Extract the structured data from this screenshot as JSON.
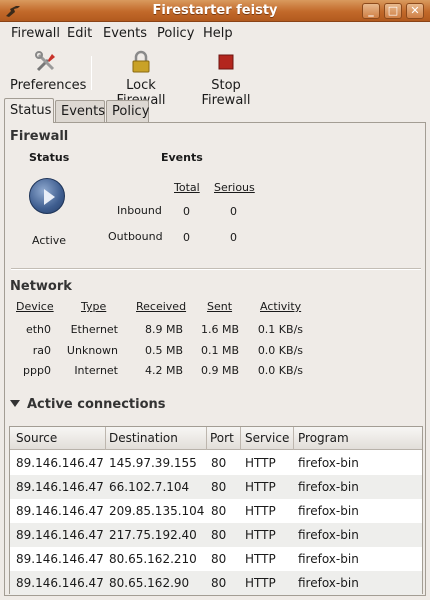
{
  "window": {
    "title": "Firestarter feisty",
    "controls": {
      "minimize": "_",
      "maximize": "□",
      "close": "✕"
    }
  },
  "menu": {
    "items": [
      "Firewall",
      "Edit",
      "Events",
      "Policy",
      "Help"
    ]
  },
  "toolbar": {
    "preferences": "Preferences",
    "lock": "Lock Firewall",
    "stop": "Stop Firewall"
  },
  "tabs": [
    "Status",
    "Events",
    "Policy"
  ],
  "firewall": {
    "section_title": "Firewall",
    "status_header": "Status",
    "events_header": "Events",
    "state": "Active",
    "col_total": "Total",
    "col_serious": "Serious",
    "rows": [
      {
        "label": "Inbound",
        "total": "0",
        "serious": "0"
      },
      {
        "label": "Outbound",
        "total": "0",
        "serious": "0"
      }
    ]
  },
  "network": {
    "section_title": "Network",
    "columns": [
      "Device",
      "Type",
      "Received",
      "Sent",
      "Activity"
    ],
    "rows": [
      {
        "device": "eth0",
        "type": "Ethernet",
        "received": "8.9 MB",
        "sent": "1.6 MB",
        "activity": "0.1 KB/s"
      },
      {
        "device": "ra0",
        "type": "Unknown",
        "received": "0.5 MB",
        "sent": "0.1 MB",
        "activity": "0.0 KB/s"
      },
      {
        "device": "ppp0",
        "type": "Internet",
        "received": "4.2 MB",
        "sent": "0.9 MB",
        "activity": "0.0 KB/s"
      }
    ]
  },
  "connections": {
    "title": "Active connections",
    "columns": [
      "Source",
      "Destination",
      "Port",
      "Service",
      "Program"
    ],
    "rows": [
      {
        "source": "89.146.146.47",
        "destination": "145.97.39.155",
        "port": "80",
        "service": "HTTP",
        "program": "firefox-bin"
      },
      {
        "source": "89.146.146.47",
        "destination": "66.102.7.104",
        "port": "80",
        "service": "HTTP",
        "program": "firefox-bin"
      },
      {
        "source": "89.146.146.47",
        "destination": "209.85.135.104",
        "port": "80",
        "service": "HTTP",
        "program": "firefox-bin"
      },
      {
        "source": "89.146.146.47",
        "destination": "217.75.192.40",
        "port": "80",
        "service": "HTTP",
        "program": "firefox-bin"
      },
      {
        "source": "89.146.146.47",
        "destination": "80.65.162.210",
        "port": "80",
        "service": "HTTP",
        "program": "firefox-bin"
      },
      {
        "source": "89.146.146.47",
        "destination": "80.65.162.90",
        "port": "80",
        "service": "HTTP",
        "program": "firefox-bin"
      }
    ]
  }
}
